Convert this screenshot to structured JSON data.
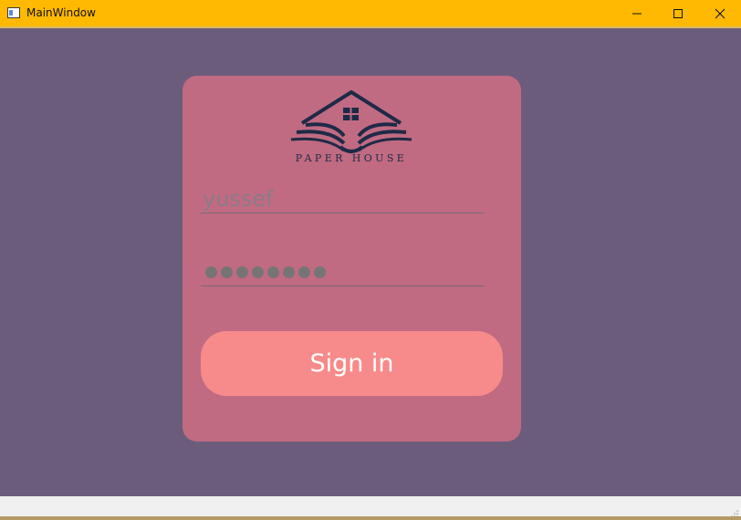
{
  "window": {
    "title": "MainWindow",
    "icons": {
      "app": "app-window-icon",
      "minimize": "minimize-icon",
      "maximize": "maximize-icon",
      "close": "close-icon"
    },
    "colors": {
      "titlebar": "#ffb900",
      "background": "#6b5c7b"
    }
  },
  "login": {
    "logo_text": "Paper House",
    "username_value": "yussef",
    "password_mask_length": 8,
    "signin_label": "Sign in",
    "colors": {
      "card": "#c06b82",
      "button": "#f78a8a",
      "logo": "#1e2a47"
    }
  }
}
